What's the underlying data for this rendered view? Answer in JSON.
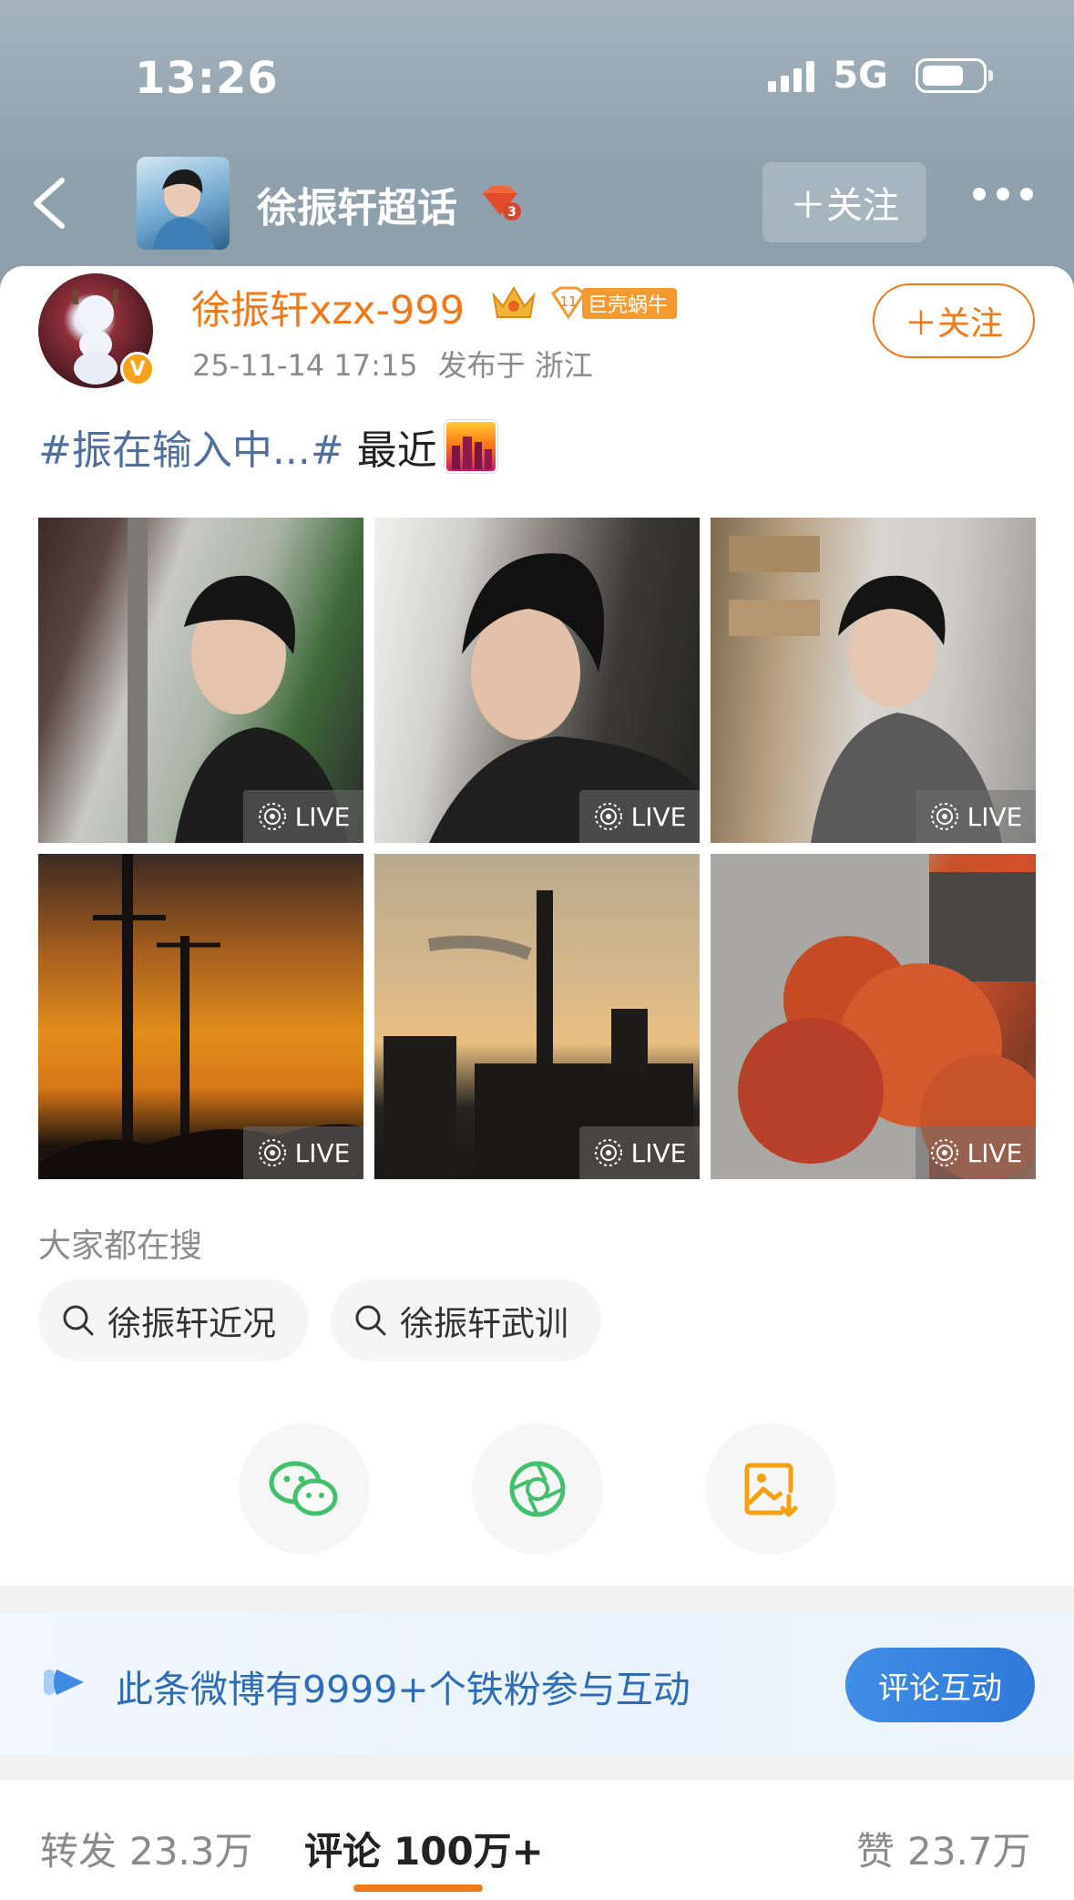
{
  "status_bar": {
    "time": "13:26",
    "network": "5G"
  },
  "nav": {
    "title": "徐振轩超话",
    "follow_label": "＋关注"
  },
  "post": {
    "username": "徐振轩xzx-999",
    "fan_badge_level": "11",
    "fan_badge_name": "巨壳蜗牛",
    "timestamp": "25-11-14 17:15",
    "location": "发布于 浙江",
    "follow_label": "＋关注",
    "hashtag": "#振在输入中...#",
    "text": "最近",
    "live_label": "LIVE",
    "photos": [
      {
        "name": "photo-1"
      },
      {
        "name": "photo-2"
      },
      {
        "name": "photo-3"
      },
      {
        "name": "photo-4"
      },
      {
        "name": "photo-5"
      },
      {
        "name": "photo-6"
      }
    ]
  },
  "search": {
    "title": "大家都在搜",
    "chips": [
      "徐振轩近况",
      "徐振轩武训"
    ]
  },
  "banner": {
    "text": "此条微博有9999+个铁粉参与互动",
    "button": "评论互动"
  },
  "tabs": {
    "repost_label": "转发",
    "repost_count": "23.3万",
    "comment_label": "评论",
    "comment_count": "100万+",
    "like_label": "赞",
    "like_count": "23.7万"
  },
  "colors": {
    "accent_orange": "#f07a1a",
    "hashtag_blue": "#4f6f9e",
    "banner_blue": "#2f6cb8"
  },
  "icons": [
    "back-icon",
    "ruby-badge-icon",
    "more-icon",
    "crown-icon",
    "search-icon",
    "wechat-icon",
    "moments-icon",
    "save-image-icon",
    "live-icon"
  ]
}
